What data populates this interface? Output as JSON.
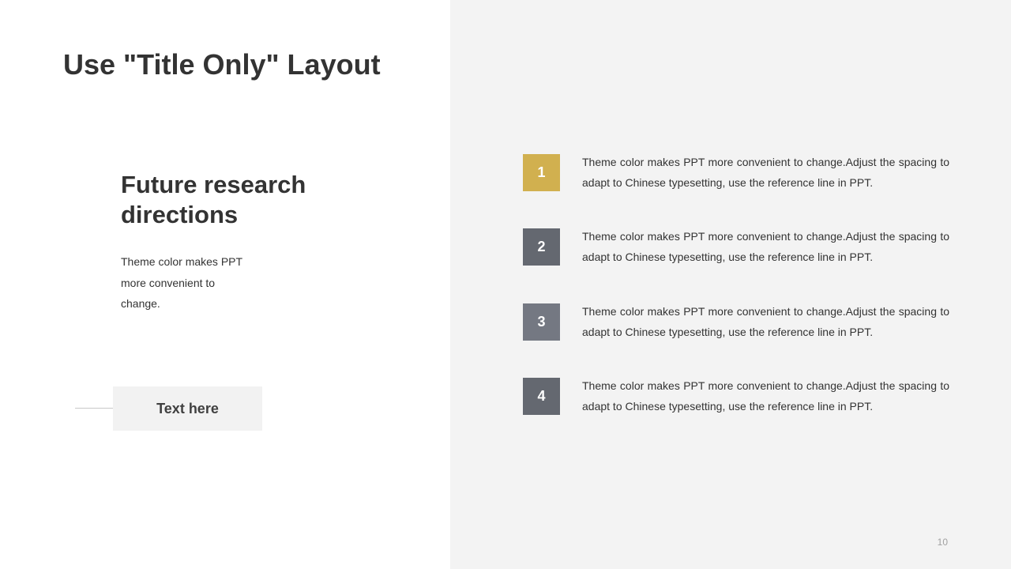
{
  "slide": {
    "title": "Use \"Title Only\" Layout",
    "page_number": "10"
  },
  "left": {
    "heading": "Future research directions",
    "body": "Theme color makes PPT more convenient to change.",
    "text_box_label": "Text here"
  },
  "items": [
    {
      "number": "1",
      "color": "#d1b04f",
      "text": "Theme color makes PPT more convenient to change.Adjust the spacing to adapt to Chinese typesetting, use the reference line in PPT."
    },
    {
      "number": "2",
      "color": "#646870",
      "text": "Theme color makes PPT more convenient to change.Adjust the spacing to adapt to Chinese typesetting, use the reference line in PPT."
    },
    {
      "number": "3",
      "color": "#747882",
      "text": "Theme color makes PPT more convenient to change.Adjust the spacing to adapt to Chinese typesetting, use the reference line in PPT."
    },
    {
      "number": "4",
      "color": "#646870",
      "text": "Theme color makes PPT more convenient to change.Adjust the spacing to adapt to Chinese typesetting, use the reference line in PPT."
    }
  ]
}
